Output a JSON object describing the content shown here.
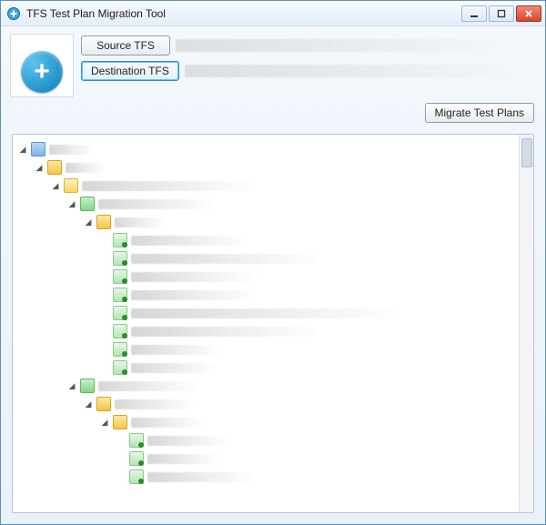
{
  "window": {
    "title": "TFS Test Plan Migration Tool"
  },
  "header": {
    "source_button": "Source TFS",
    "destination_button": "Destination TFS",
    "source_value_redacted": true,
    "destination_value_redacted": true,
    "selected_button": "destination"
  },
  "actions": {
    "migrate_button": "Migrate Test Plans"
  },
  "tree": {
    "root": {
      "icon": "root",
      "label_redacted": true,
      "label_width": 50,
      "expanded": true,
      "children": [
        {
          "icon": "team",
          "label_redacted": true,
          "label_width": 44,
          "expanded": true,
          "children": [
            {
              "icon": "plan",
              "label_redacted": true,
              "label_width": 190,
              "expanded": true,
              "children": [
                {
                  "icon": "suite",
                  "label_redacted": true,
                  "label_width": 130,
                  "expanded": true,
                  "children": [
                    {
                      "icon": "suite2",
                      "label_redacted": true,
                      "label_width": 56,
                      "expanded": true,
                      "children": [
                        {
                          "icon": "test",
                          "label_redacted": true,
                          "label_width": 130
                        },
                        {
                          "icon": "test",
                          "label_redacted": true,
                          "label_width": 210
                        },
                        {
                          "icon": "test",
                          "label_redacted": true,
                          "label_width": 140
                        },
                        {
                          "icon": "test",
                          "label_redacted": true,
                          "label_width": 140
                        },
                        {
                          "icon": "test",
                          "label_redacted": true,
                          "label_width": 300
                        },
                        {
                          "icon": "test",
                          "label_redacted": true,
                          "label_width": 210
                        },
                        {
                          "icon": "test",
                          "label_redacted": true,
                          "label_width": 100
                        },
                        {
                          "icon": "test",
                          "label_redacted": true,
                          "label_width": 95
                        }
                      ]
                    }
                  ]
                },
                {
                  "icon": "suite",
                  "label_redacted": true,
                  "label_width": 110,
                  "expanded": true,
                  "children": [
                    {
                      "icon": "suite2",
                      "label_redacted": true,
                      "label_width": 90,
                      "expanded": true,
                      "children": [
                        {
                          "icon": "suite2",
                          "label_redacted": true,
                          "label_width": 80,
                          "expanded": true,
                          "children": [
                            {
                              "icon": "test",
                              "label_redacted": true,
                              "label_width": 90
                            },
                            {
                              "icon": "test",
                              "label_redacted": true,
                              "label_width": 80
                            },
                            {
                              "icon": "test",
                              "label_redacted": true,
                              "label_width": 120
                            }
                          ]
                        }
                      ]
                    }
                  ]
                }
              ]
            }
          ]
        }
      ]
    }
  }
}
